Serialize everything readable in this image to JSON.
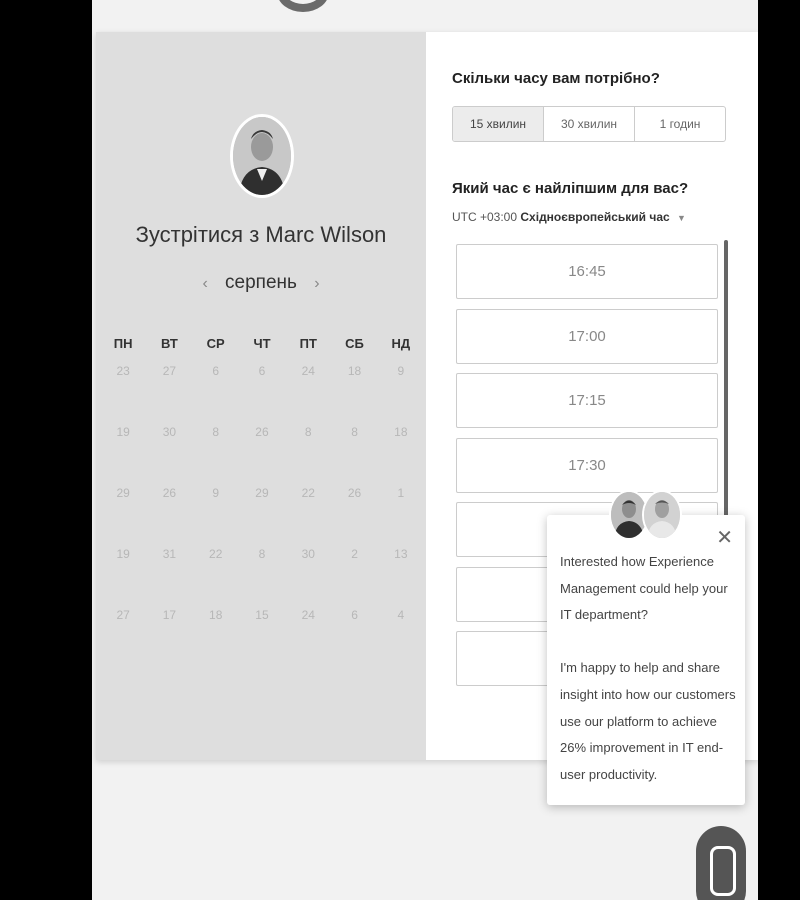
{
  "meet": {
    "title": "Зустрітися з Marc Wilson"
  },
  "calendar": {
    "month": "серпень",
    "prev_icon": "‹",
    "next_icon": "›",
    "weekdays": [
      "ПН",
      "ВТ",
      "СР",
      "ЧТ",
      "ПТ",
      "СБ",
      "НД"
    ],
    "weeks": [
      [
        "23",
        "27",
        "6",
        "6",
        "24",
        "18",
        "9"
      ],
      [
        "19",
        "30",
        "8",
        "26",
        "8",
        "8",
        "18"
      ],
      [
        "29",
        "26",
        "9",
        "29",
        "22",
        "26",
        "1"
      ],
      [
        "19",
        "31",
        "22",
        "8",
        "30",
        "2",
        "13"
      ],
      [
        "27",
        "17",
        "18",
        "15",
        "24",
        "6",
        "4"
      ]
    ]
  },
  "booking": {
    "duration_question": "Скільки часу вам потрібно?",
    "durations": [
      "15 хвилин",
      "30 хвилин",
      "1 годин"
    ],
    "time_question": "Який час є найліпшим для вас?",
    "timezone_prefix": "UTC +03:00",
    "timezone_name": "Східноєвропейський час",
    "caret_icon": "▼",
    "slots": [
      "16:45",
      "17:00",
      "17:15",
      "17:30",
      "",
      "",
      ""
    ]
  },
  "popup": {
    "close_icon": "✕",
    "paragraph1": "Interested how Experience Management could help your IT department?",
    "paragraph2": "I'm happy to help and share insight into how our customers use our platform to achieve 26% improvement in IT end-user productivity."
  },
  "colors": {
    "panel_left": "#dedede",
    "panel_right": "#ffffff",
    "accent": "#ececec"
  }
}
